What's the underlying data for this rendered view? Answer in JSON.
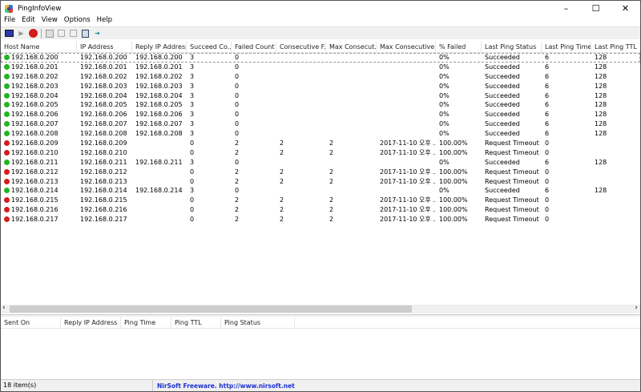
{
  "window": {
    "title": "PingInfoView"
  },
  "menu": [
    "File",
    "Edit",
    "View",
    "Options",
    "Help"
  ],
  "toolbar": [
    "options-icon",
    "start-icon",
    "stop-icon",
    "save-icon",
    "copy-icon",
    "properties-icon",
    "find-icon",
    "exit-icon"
  ],
  "colors": {
    "success": "#22b422",
    "fail": "#d41c1c",
    "link": "#1a2fd0"
  },
  "columns": [
    "Host Name",
    "IP Address",
    "Reply IP Address",
    "Succeed Co...",
    "Failed Count",
    "Consecutive F...",
    "Max Consecut...",
    "Max Consecutive ...",
    "% Failed",
    "Last Ping Status",
    "Last Ping Time",
    "Last Ping TTL"
  ],
  "rows": [
    [
      "192.168.0.200",
      "192.168.0.200",
      "192.168.0.200",
      "3",
      "0",
      "",
      "",
      "",
      "0%",
      "Succeeded",
      "6",
      "128"
    ],
    [
      "192.168.0.201",
      "192.168.0.201",
      "192.168.0.201",
      "3",
      "0",
      "",
      "",
      "",
      "0%",
      "Succeeded",
      "6",
      "128"
    ],
    [
      "192.168.0.202",
      "192.168.0.202",
      "192.168.0.202",
      "3",
      "0",
      "",
      "",
      "",
      "0%",
      "Succeeded",
      "6",
      "128"
    ],
    [
      "192.168.0.203",
      "192.168.0.203",
      "192.168.0.203",
      "3",
      "0",
      "",
      "",
      "",
      "0%",
      "Succeeded",
      "6",
      "128"
    ],
    [
      "192.168.0.204",
      "192.168.0.204",
      "192.168.0.204",
      "3",
      "0",
      "",
      "",
      "",
      "0%",
      "Succeeded",
      "6",
      "128"
    ],
    [
      "192.168.0.205",
      "192.168.0.205",
      "192.168.0.205",
      "3",
      "0",
      "",
      "",
      "",
      "0%",
      "Succeeded",
      "6",
      "128"
    ],
    [
      "192.168.0.206",
      "192.168.0.206",
      "192.168.0.206",
      "3",
      "0",
      "",
      "",
      "",
      "0%",
      "Succeeded",
      "6",
      "128"
    ],
    [
      "192.168.0.207",
      "192.168.0.207",
      "192.168.0.207",
      "3",
      "0",
      "",
      "",
      "",
      "0%",
      "Succeeded",
      "6",
      "128"
    ],
    [
      "192.168.0.208",
      "192.168.0.208",
      "192.168.0.208",
      "3",
      "0",
      "",
      "",
      "",
      "0%",
      "Succeeded",
      "6",
      "128"
    ],
    [
      "192.168.0.209",
      "192.168.0.209",
      "",
      "0",
      "2",
      "2",
      "2",
      "2017-11-10 오후 ...",
      "100.00%",
      "Request Timeout",
      "0",
      ""
    ],
    [
      "192.168.0.210",
      "192.168.0.210",
      "",
      "0",
      "2",
      "2",
      "2",
      "2017-11-10 오후 ...",
      "100.00%",
      "Request Timeout",
      "0",
      ""
    ],
    [
      "192.168.0.211",
      "192.168.0.211",
      "192.168.0.211",
      "3",
      "0",
      "",
      "",
      "",
      "0%",
      "Succeeded",
      "6",
      "128"
    ],
    [
      "192.168.0.212",
      "192.168.0.212",
      "",
      "0",
      "2",
      "2",
      "2",
      "2017-11-10 오후 ...",
      "100.00%",
      "Request Timeout",
      "0",
      ""
    ],
    [
      "192.168.0.213",
      "192.168.0.213",
      "",
      "0",
      "2",
      "2",
      "2",
      "2017-11-10 오후 ...",
      "100.00%",
      "Request Timeout",
      "0",
      ""
    ],
    [
      "192.168.0.214",
      "192.168.0.214",
      "192.168.0.214",
      "3",
      "0",
      "",
      "",
      "",
      "0%",
      "Succeeded",
      "6",
      "128"
    ],
    [
      "192.168.0.215",
      "192.168.0.215",
      "",
      "0",
      "2",
      "2",
      "2",
      "2017-11-10 오후 ...",
      "100.00%",
      "Request Timeout",
      "0",
      ""
    ],
    [
      "192.168.0.216",
      "192.168.0.216",
      "",
      "0",
      "2",
      "2",
      "2",
      "2017-11-10 오후 ...",
      "100.00%",
      "Request Timeout",
      "0",
      ""
    ],
    [
      "192.168.0.217",
      "192.168.0.217",
      "",
      "0",
      "2",
      "2",
      "2",
      "2017-11-10 오후 ...",
      "100.00%",
      "Request Timeout",
      "0",
      ""
    ]
  ],
  "lower_columns": [
    "Sent On",
    "Reply IP Address",
    "Ping Time",
    "Ping TTL",
    "Ping Status"
  ],
  "status": {
    "items": "18 item(s)",
    "credit": "NirSoft Freeware.  http://www.nirsoft.net"
  }
}
